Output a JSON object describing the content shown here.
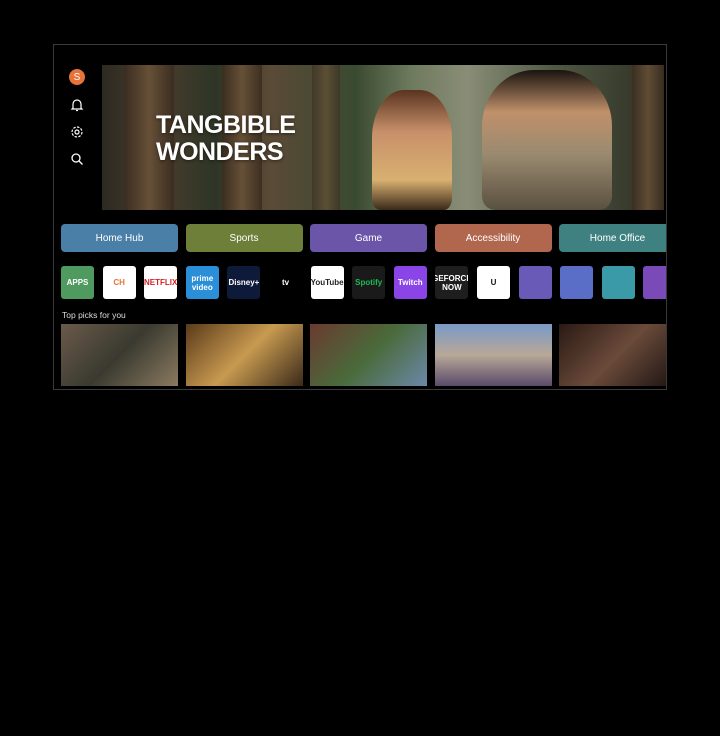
{
  "sidebar": {
    "avatar_letter": "S",
    "icons": [
      "bell-icon",
      "gear-icon",
      "search-icon"
    ]
  },
  "hero": {
    "title_line1": "TANGBIBLE",
    "title_line2": "WONDERS"
  },
  "categories": [
    {
      "label": "Home Hub",
      "color": "#4a7fa8"
    },
    {
      "label": "Sports",
      "color": "#6e7f3a"
    },
    {
      "label": "Game",
      "color": "#6a55a8"
    },
    {
      "label": "Accessibility",
      "color": "#b0674e"
    },
    {
      "label": "Home Office",
      "color": "#3f8080"
    }
  ],
  "apps": [
    {
      "label": "APPS",
      "bg": "#4f9a5e",
      "fg": "#fff"
    },
    {
      "label": "CH",
      "bg": "#ffffff",
      "fg": "#e8733a"
    },
    {
      "label": "NETFLIX",
      "bg": "#ffffff",
      "fg": "#d81f26"
    },
    {
      "label": "prime video",
      "bg": "#2a8fd8",
      "fg": "#fff"
    },
    {
      "label": "Disney+",
      "bg": "#0e1a3a",
      "fg": "#fff"
    },
    {
      "label": "tv",
      "bg": "#000000",
      "fg": "#fff"
    },
    {
      "label": "YouTube",
      "bg": "#ffffff",
      "fg": "#222"
    },
    {
      "label": "Spotify",
      "bg": "#1a1a1a",
      "fg": "#1db954"
    },
    {
      "label": "Twitch",
      "bg": "#8a44e8",
      "fg": "#fff"
    },
    {
      "label": "GEFORCE NOW",
      "bg": "#1e1e1e",
      "fg": "#fff"
    },
    {
      "label": "U",
      "bg": "#ffffff",
      "fg": "#111"
    },
    {
      "label": "",
      "bg": "#6a5ab8",
      "fg": "#fff"
    },
    {
      "label": "",
      "bg": "#5a6ec8",
      "fg": "#fff"
    },
    {
      "label": "",
      "bg": "#3a9aa8",
      "fg": "#fff"
    },
    {
      "label": "",
      "bg": "#7a4ab8",
      "fg": "#fff"
    }
  ],
  "top_picks": {
    "heading": "Top picks for you",
    "thumbs": [
      {
        "bg": "linear-gradient(135deg,#6a5a4a,#3a3a30,#8a7a60)"
      },
      {
        "bg": "linear-gradient(135deg,#5a3a1a,#c89a50,#3a2a1a)"
      },
      {
        "bg": "linear-gradient(135deg,#6a3a30,#4a6a3a,#6a88a8)"
      },
      {
        "bg": "linear-gradient(180deg,#7a9ac8,#b8a898,#5a4a6a)"
      },
      {
        "bg": "linear-gradient(135deg,#2a1a14,#6a4a3a,#1a1210)"
      }
    ]
  }
}
